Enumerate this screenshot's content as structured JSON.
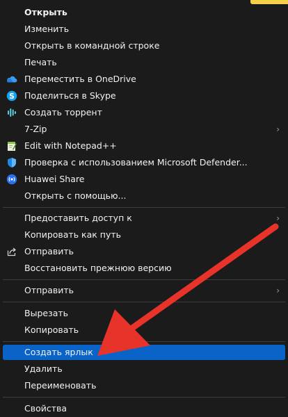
{
  "menu": {
    "items": [
      {
        "label": "Открыть"
      },
      {
        "label": "Изменить"
      },
      {
        "label": "Открыть в  командной строке"
      },
      {
        "label": "Печать"
      },
      {
        "label": "Переместить в OneDrive",
        "icon": "onedrive-icon"
      },
      {
        "label": "Поделиться в Skype",
        "icon": "skype-icon"
      },
      {
        "label": "Создать  торрент",
        "icon": "torrent-icon"
      },
      {
        "label": "7-Zip"
      },
      {
        "label": "Edit with Notepad++",
        "icon": "notepad-plus-plus-icon"
      },
      {
        "label": "Проверка с использованием Microsoft Defender...",
        "icon": "defender-shield-icon"
      },
      {
        "label": "Huawei Share",
        "icon": "huawei-share-icon"
      },
      {
        "label": "Открыть с помощью..."
      },
      {
        "label": "Предоставить доступ к"
      },
      {
        "label": "Копировать как путь"
      },
      {
        "label": "Отправить",
        "icon": "share-icon"
      },
      {
        "label": "Восстановить прежнюю версию"
      },
      {
        "label": "Отправить"
      },
      {
        "label": "Вырезать"
      },
      {
        "label": "Копировать"
      },
      {
        "label": "Создать ярлык"
      },
      {
        "label": "Удалить"
      },
      {
        "label": "Переименовать"
      },
      {
        "label": "Свойства"
      }
    ],
    "submenu_glyph": "›"
  },
  "colors": {
    "menu_background": "#1b1b1b",
    "highlight": "#0a64c8",
    "separator": "#3d3d3d",
    "arrow": "#e8332b",
    "text": "#f2f2f2"
  },
  "annotation": {
    "icon": "red-pointer-arrow-icon"
  }
}
